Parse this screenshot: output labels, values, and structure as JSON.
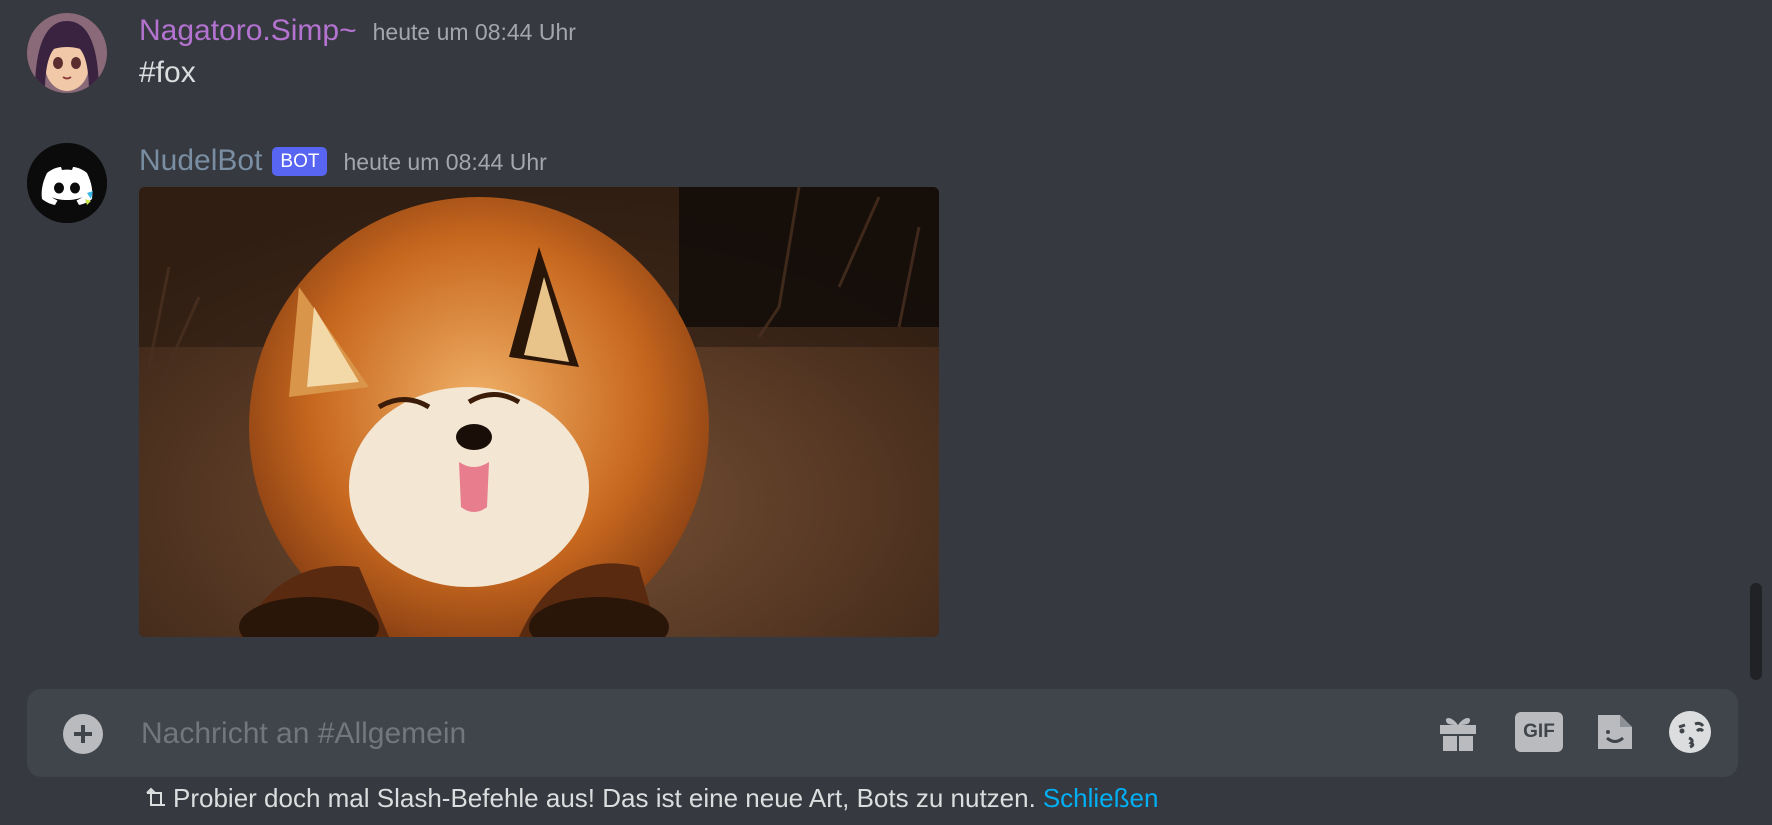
{
  "messages": [
    {
      "author": "Nagatoro.Simp~",
      "author_color": "#b473d1",
      "timestamp": "heute um 08:44 Uhr",
      "content": "#fox"
    },
    {
      "author": "NudelBot",
      "author_color": "#7a8ea3",
      "bot_tag": "BOT",
      "timestamp": "heute um 08:44 Uhr",
      "attachment_icon": "fox-photo"
    }
  ],
  "composer": {
    "placeholder": "Nachricht an #Allgemein",
    "value": "",
    "gif_label": "GIF",
    "icons": [
      "plus-circle-icon",
      "gift-icon",
      "gif-icon",
      "sticker-icon",
      "emoji-icon"
    ]
  },
  "hint": {
    "text": "Probier doch mal Slash-Befehle aus! Das ist eine neue Art, Bots zu nutzen.",
    "link": "Schließen"
  },
  "colors": {
    "background": "#36393f",
    "composer": "#40444b",
    "bot_tag": "#5865f2",
    "link": "#00aff4"
  }
}
